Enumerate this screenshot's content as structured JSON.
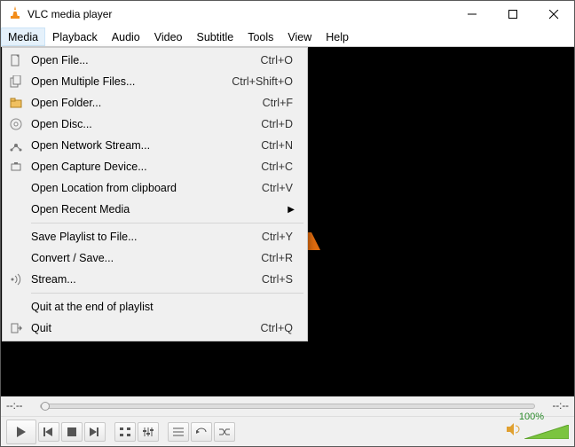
{
  "titlebar": {
    "title": "VLC media player"
  },
  "menubar": [
    "Media",
    "Playback",
    "Audio",
    "Video",
    "Subtitle",
    "Tools",
    "View",
    "Help"
  ],
  "active_menu_index": 0,
  "dropdown": {
    "groups": [
      [
        {
          "icon": "file",
          "label": "Open File...",
          "shortcut": "Ctrl+O"
        },
        {
          "icon": "files",
          "label": "Open Multiple Files...",
          "shortcut": "Ctrl+Shift+O"
        },
        {
          "icon": "folder",
          "label": "Open Folder...",
          "shortcut": "Ctrl+F"
        },
        {
          "icon": "disc",
          "label": "Open Disc...",
          "shortcut": "Ctrl+D"
        },
        {
          "icon": "network",
          "label": "Open Network Stream...",
          "shortcut": "Ctrl+N"
        },
        {
          "icon": "capture",
          "label": "Open Capture Device...",
          "shortcut": "Ctrl+C"
        },
        {
          "icon": "",
          "label": "Open Location from clipboard",
          "shortcut": "Ctrl+V"
        },
        {
          "icon": "",
          "label": "Open Recent Media",
          "shortcut": "",
          "submenu": true
        }
      ],
      [
        {
          "icon": "",
          "label": "Save Playlist to File...",
          "shortcut": "Ctrl+Y"
        },
        {
          "icon": "",
          "label": "Convert / Save...",
          "shortcut": "Ctrl+R"
        },
        {
          "icon": "stream",
          "label": "Stream...",
          "shortcut": "Ctrl+S"
        }
      ],
      [
        {
          "icon": "",
          "label": "Quit at the end of playlist",
          "shortcut": ""
        },
        {
          "icon": "quit",
          "label": "Quit",
          "shortcut": "Ctrl+Q"
        }
      ]
    ]
  },
  "seekbar": {
    "time_left": "--:--",
    "time_right": "--:--"
  },
  "volume": {
    "percent_label": "100%"
  }
}
